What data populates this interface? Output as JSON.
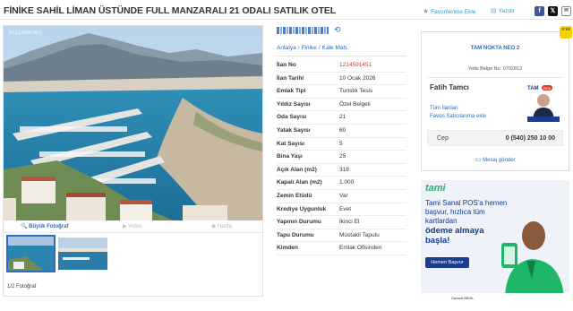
{
  "listing": {
    "title": "FİNİKE SAHİL LİMAN ÜSTÜNDE FULL MANZARALI 21 ODALI SATILIK OTEL"
  },
  "actions": {
    "favorite": "Favorilerime Ekle",
    "print": "Yazdır",
    "share_icons": [
      "facebook-icon",
      "x-icon",
      "mail-icon"
    ]
  },
  "gallery": {
    "photo_id": "#1214591451",
    "big_photo": "Büyük Fotoğraf",
    "video": "Video",
    "map": "Harita",
    "counter": "1/2 Fotoğraf"
  },
  "breadcrumbs": [
    "Antalya",
    "Finike",
    "Kale Mah."
  ],
  "details": [
    {
      "key": "İlan No",
      "value": "1214591451",
      "accent": true
    },
    {
      "key": "İlan Tarihi",
      "value": "10 Ocak 2026"
    },
    {
      "key": "Emlak Tipi",
      "value": "Turistik Tesis"
    },
    {
      "key": "Yıldız Sayısı",
      "value": "Özel Belgeli"
    },
    {
      "key": "Oda Sayısı",
      "value": "21"
    },
    {
      "key": "Yatak Sayısı",
      "value": "60"
    },
    {
      "key": "Kat Sayısı",
      "value": "5"
    },
    {
      "key": "Bina Yaşı",
      "value": "25"
    },
    {
      "key": "Açık Alan (m2)",
      "value": "318"
    },
    {
      "key": "Kapalı Alan (m2)",
      "value": "1.000"
    },
    {
      "key": "Zemin Etüdü",
      "value": "Var"
    },
    {
      "key": "Krediye Uygunluk",
      "value": "Evet"
    },
    {
      "key": "Yapının Durumu",
      "value": "İkinci El"
    },
    {
      "key": "Tapu Durumu",
      "value": "Müstakil Tapulu"
    },
    {
      "key": "Kimden",
      "value": "Emlak Ofisinden"
    }
  ],
  "seller": {
    "company": "TAM NOKTA NEO 2",
    "badge": "3 Yıl",
    "certificate": "Yetki Belge No: 0702813",
    "name": "Fatih Tamcı",
    "logo_text": "TAM",
    "logo_brand": "Neo",
    "all_listings": "Tüm İlanları",
    "favorite_seller": "Favori Satıcılarıma ekle",
    "phone_label": "Cep",
    "phone": "0 (540) 250 10 00",
    "message": "Mesaj gönder"
  },
  "ad": {
    "logo": "tami",
    "line1": "Tami Sanal POS'a hemen başvur, hızlıca tüm kartlardan",
    "line2": "ödeme almaya başla!",
    "button": "Hemen Başvur",
    "footer": "Garanti BBVA"
  },
  "colors": {
    "link": "#2a6cbf",
    "accent_red": "#d63a2b",
    "ad_green": "#1fb66a",
    "ad_navy": "#123b8a"
  }
}
